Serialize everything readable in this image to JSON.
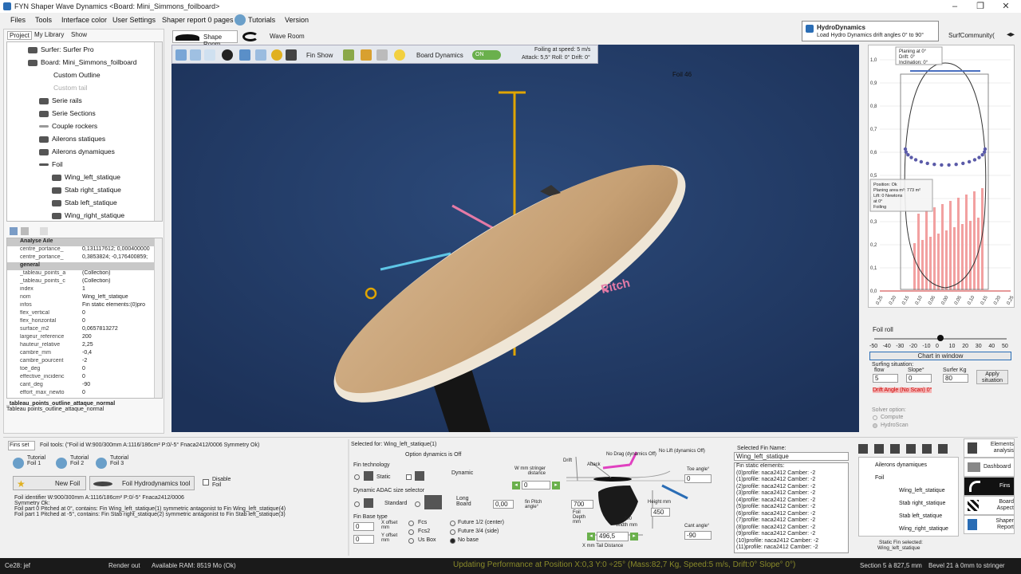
{
  "window": {
    "title": "FYN Shaper Wave Dynamics   <Board: Mini_Simmons_foilboard>"
  },
  "menu": [
    "Files",
    "Tools",
    "Interface color",
    "User Settings",
    "Shaper report 0 pages",
    "Tutorials",
    "Version"
  ],
  "left_tabs": [
    "Project",
    "My Library",
    "Show"
  ],
  "tree": [
    {
      "label": "Surfer: Surfer Pro",
      "indent": 0
    },
    {
      "label": "Board: Mini_Simmons_foilboard",
      "indent": 0
    },
    {
      "label": "Custom Outline",
      "indent": 2
    },
    {
      "label": "Custom tail",
      "indent": 2
    },
    {
      "label": "Serie rails",
      "indent": 2
    },
    {
      "label": "Serie Sections",
      "indent": 2
    },
    {
      "label": "Couple rockers",
      "indent": 2
    },
    {
      "label": "Ailerons statiques",
      "indent": 2
    },
    {
      "label": "Ailerons dynamiques",
      "indent": 2
    },
    {
      "label": "Foil",
      "indent": 2
    },
    {
      "label": "Wing_left_statique",
      "indent": 4
    },
    {
      "label": "Stab right_statique",
      "indent": 4
    },
    {
      "label": "Stab left_statique",
      "indent": 4
    },
    {
      "label": "Wing_right_statique",
      "indent": 4
    }
  ],
  "properties": [
    {
      "section": "Analyse Aile"
    },
    {
      "k": "centre_portance_",
      "v": "0,131117612; 0,000400000"
    },
    {
      "k": "centre_portance_",
      "v": "0,3853824; -0,176400859;"
    },
    {
      "section": "general"
    },
    {
      "k": "_tableau_points_a",
      "v": "(Collection)"
    },
    {
      "k": "_tableau_points_c",
      "v": "(Collection)"
    },
    {
      "k": "index",
      "v": "1"
    },
    {
      "k": "nom",
      "v": "Wing_left_statique"
    },
    {
      "k": "infos",
      "v": "Fin static elements:(0)pro"
    },
    {
      "k": "flex_vertical",
      "v": "0"
    },
    {
      "k": "flex_horizontal",
      "v": "0"
    },
    {
      "k": "surface_m2",
      "v": "0,0657813272"
    },
    {
      "k": "largeur_reference",
      "v": "200"
    },
    {
      "k": "hauteur_relative",
      "v": "2,25"
    },
    {
      "k": "cambre_mm",
      "v": "-0,4"
    },
    {
      "k": "cambre_pourcent",
      "v": "-2"
    },
    {
      "k": "toe_deg",
      "v": "0"
    },
    {
      "k": "effective_incidenc",
      "v": "0"
    },
    {
      "k": "cant_deg",
      "v": "-90"
    },
    {
      "k": "effort_max_newto",
      "v": "0"
    }
  ],
  "prop_desc": {
    "title": "_tableau_points_outline_attaque_normal",
    "text": "Tableau points_outline_attaque_normal"
  },
  "view_tabs": [
    "Shape Room",
    "Wave Room"
  ],
  "viewport_toolbar": {
    "fin_show": "Fin Show",
    "board_dynamics": "Board Dynamics",
    "toggle": "ON",
    "foiling1": "Foiling at speed: 5 m/s",
    "foiling2": "Attack: 5,5° Roll: 0° Drift: 0°"
  },
  "viewport": {
    "foil_label": "Foil 46",
    "pitch": "Pitch"
  },
  "notification": {
    "title": "HydroDynamics",
    "text": "Load Hydro Dynamics drift angles 0° to 90°"
  },
  "community": "SurfCommunity(",
  "chart": {
    "box1": [
      "Planing at 0°",
      "Drift: 0°",
      "Inclination: 0°"
    ],
    "box2": [
      "Position: Ok",
      "Planing area m²: 773 m²",
      "Lift: 0 Newtons",
      "at 0°",
      "Foiling"
    ],
    "yticks": [
      "1,0",
      "0,9",
      "0,8",
      "0,7",
      "0,6",
      "0,5",
      "0,4",
      "0,3",
      "0,2",
      "0,1",
      "0,0"
    ],
    "xticks": [
      "0,25",
      "0,20",
      "0,15",
      "0,10",
      "0,05",
      "0,00",
      "0,05",
      "0,10",
      "0,15",
      "0,20",
      "0,25"
    ]
  },
  "foil_roll": {
    "label": "Foil roll",
    "ticks": [
      "-50",
      "-40",
      "-30",
      "-20",
      "-10",
      "0",
      "10",
      "20",
      "30",
      "40",
      "50"
    ],
    "value": 0
  },
  "chart_window_btn": "Chart in window",
  "surfing": {
    "label": "Surfing situation:",
    "flow_label": "flow",
    "flow": "5",
    "slope_label": "Slope°",
    "slope": "0",
    "kg_label": "Surfer Kg",
    "kg": "80",
    "apply": "Apply situation",
    "drift": "Drift Angle (No Scan) 0°"
  },
  "solver": {
    "label": "Solver option:",
    "compute": "Compute",
    "hydroscan": "HydroScan"
  },
  "bottom_tabs": {
    "fin_set": "Fins set",
    "fin_tools": "Foil tools: (\"Foil id W:900/300mm A:1116/186cm² P:0/-5° Fnaca2412/0006 Symmetry Ok)"
  },
  "tutorials": [
    "Tutorial Foil 1",
    "Tutorial Foil 2",
    "Tutorial Foil 3"
  ],
  "new_foil": "New Foil",
  "foil_hydro_tool": "Foil Hydrodynamics tool",
  "disable_foil": "Disable Foil",
  "foil_info": [
    "Foil identifier W:900/300mm A:1116/186cm² P:0/-5° Fnaca2412/0006",
    "Symmetry Ok:",
    "Foil part 0 Pitched at  0°, contains: Fin Wing_left_statique(1) symmetric antagonist to Fin Wing_left_statique(4)",
    "Foil part 1 Pitched at  -5°, contains: Fin Stab right_statique(2) symmetric antagonist to Fin Stab left_statique(3)"
  ],
  "fin_settings": {
    "selected_for": "Selected for: Wing_left_statique(1)",
    "option_dyn": "Option dynamics is Off",
    "technology": "Fin technology",
    "static": "Static",
    "dynamic": "Dynamic",
    "adac": "Dynamic ADAC size selector",
    "standard": "Standard",
    "long_board": "Long Board",
    "adac_value": "0,00",
    "base_type": "Fin Base type",
    "fcs": "Fcs",
    "fcs2": "Fcs2",
    "usbox": "Us Box",
    "future12": "Future 1/2 (center)",
    "future34": "Future 3/4 (side)",
    "nobase": "No base",
    "x_offset": "X offset mm",
    "y_offset": "Y offset mm",
    "x_off_val": "0",
    "y_off_val": "0"
  },
  "geom": {
    "w_mm": "W mm stringer distance",
    "w_val": "0",
    "no_drag": "No Drag (dynamics Off)",
    "no_lift": "No Lift (dynamics Off)",
    "toe": "Toe angle°",
    "toe_val": "0",
    "fin_pitch": "fin Pitch angle°",
    "depth": "Foil Depth mm",
    "depth_val": "700",
    "width": "Width mm",
    "width_val": "200",
    "height": "Height mm",
    "height_val": "450",
    "cant": "Cant angle°",
    "cant_val": "-90",
    "tail": "X mm Tail Distance",
    "tail_val": "496,5",
    "drift": "Drift",
    "attack": "Attack"
  },
  "selected_fin": {
    "label": "Selected Fin Name:",
    "name": "Wing_left_statique",
    "elements": [
      "Fin static elements:",
      "(0)profile: naca2412 Camber: -2",
      "(1)profile: naca2412 Camber: -2",
      "(2)profile: naca2412 Camber: -2",
      "(3)profile: naca2412 Camber: -2",
      "(4)profile: naca2412 Camber: -2",
      "(5)profile: naca2412 Camber: -2",
      "(6)profile: naca2412 Camber: -2",
      "(7)profile: naca2412 Camber: -2",
      "(8)profile: naca2412 Camber: -2",
      "(9)profile: naca2412 Camber: -2",
      "(10)profile: naca2412 Camber: -2",
      "(11)profile: naca2412 Camber: -2"
    ]
  },
  "fin_tree": [
    "Ailerons dynamiques",
    "Foil",
    "Wing_left_statique",
    "Stab right_statique",
    "Stab left_statique",
    "Wing_right_statique"
  ],
  "static_fin_selected": [
    "Static Fin selected:",
    "Wing_left_statique"
  ],
  "nav": [
    "Elements analysis",
    "Dashboard",
    "Fins",
    "Board Aspect",
    "Shaper Report"
  ],
  "status": {
    "left": "Ce28: jef",
    "render": "Render out",
    "ram": "Available RAM: 8519 Mo (Ok)",
    "updating": "Updating Performance at Position X:0,3 Y:0 ÷25° (Mass:82,7 Kg, Speed:5 m/s, Drift:0° Slope° 0°)",
    "section": "Section 5 à 827,5 mm",
    "bevel": "Bevel 21 à 0mm to stringer"
  },
  "colors": {
    "viewport_bg": "#223a64",
    "board": "#c9a57a",
    "yellow_axis": "#e0a500",
    "pink_axis": "#e57aa6",
    "accent": "#2a6db5"
  }
}
